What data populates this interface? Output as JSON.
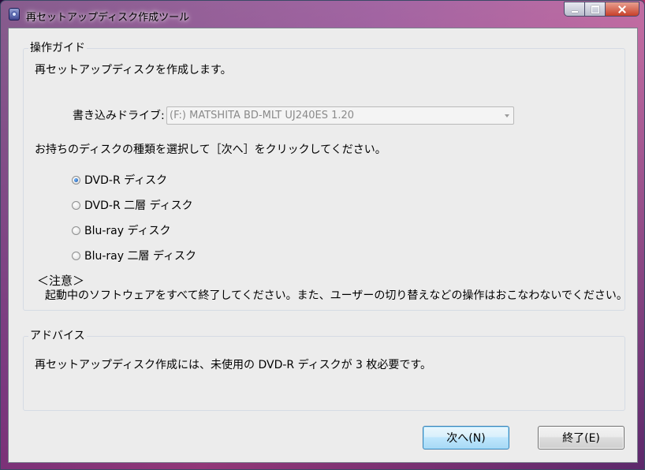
{
  "window": {
    "title": "再セットアップディスク作成ツール",
    "icon": "disc-tool-icon"
  },
  "guide": {
    "group_label": "操作ガイド",
    "intro": "再セットアップディスクを作成します。",
    "drive_label": "書き込みドライブ:",
    "drive_value": "(F:) MATSHITA BD-MLT UJ240ES 1.20",
    "instruction": "お持ちのディスクの種類を選択して［次へ］をクリックしてください。",
    "disc_options": [
      {
        "label": "DVD-R ディスク",
        "checked": true
      },
      {
        "label": "DVD-R 二層 ディスク",
        "checked": false
      },
      {
        "label": "Blu-ray ディスク",
        "checked": false
      },
      {
        "label": "Blu-ray 二層 ディスク",
        "checked": false
      }
    ],
    "caution_title": "＜注意＞",
    "caution_text": "起動中のソフトウェアをすべて終了してください。また、ユーザーの切り替えなどの操作はおこなわないでください。"
  },
  "advice": {
    "group_label": "アドバイス",
    "text": "再セットアップディスク作成には、未使用の DVD-R ディスクが 3 枚必要です。"
  },
  "buttons": {
    "next_label": "次へ(N)",
    "end_label": "終了(E)"
  }
}
